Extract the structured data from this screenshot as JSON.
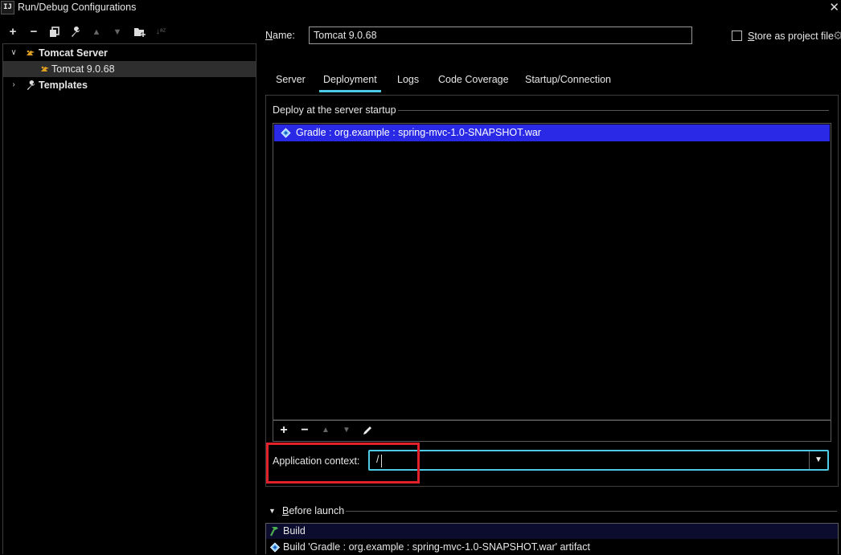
{
  "window": {
    "title": "Run/Debug Configurations",
    "logo": "IJ"
  },
  "toolbar": {
    "icons": [
      "add-icon",
      "remove-icon",
      "copy-icon",
      "wrench-icon",
      "move-up-icon",
      "move-down-icon",
      "new-folder-icon",
      "sort-icon"
    ],
    "sort_glyph": "↓ᵃᶻ"
  },
  "tree": {
    "group": "Tomcat Server",
    "child": "Tomcat 9.0.68",
    "templates": "Templates"
  },
  "form": {
    "name_label_prefix": "N",
    "name_label_rest": "ame:",
    "name_value": "Tomcat 9.0.68",
    "store_label_prefix": "S",
    "store_label_rest": "tore as project file",
    "store_checked": false
  },
  "tabs": [
    "Server",
    "Deployment",
    "Logs",
    "Code Coverage",
    "Startup/Connection"
  ],
  "active_tab": "Deployment",
  "deploy": {
    "section_title": "Deploy at the server startup",
    "artifacts": [
      "Gradle : org.example : spring-mvc-1.0-SNAPSHOT.war"
    ],
    "context_label": "Application context:",
    "context_value": "/"
  },
  "before_launch": {
    "label": "Before launch",
    "items": [
      "Build",
      "Build 'Gradle : org.example : spring-mvc-1.0-SNAPSHOT.war' artifact"
    ]
  },
  "colors": {
    "accent": "#4ec9e6",
    "selection": "#2a2ae6",
    "highlight": "#e0202a"
  }
}
